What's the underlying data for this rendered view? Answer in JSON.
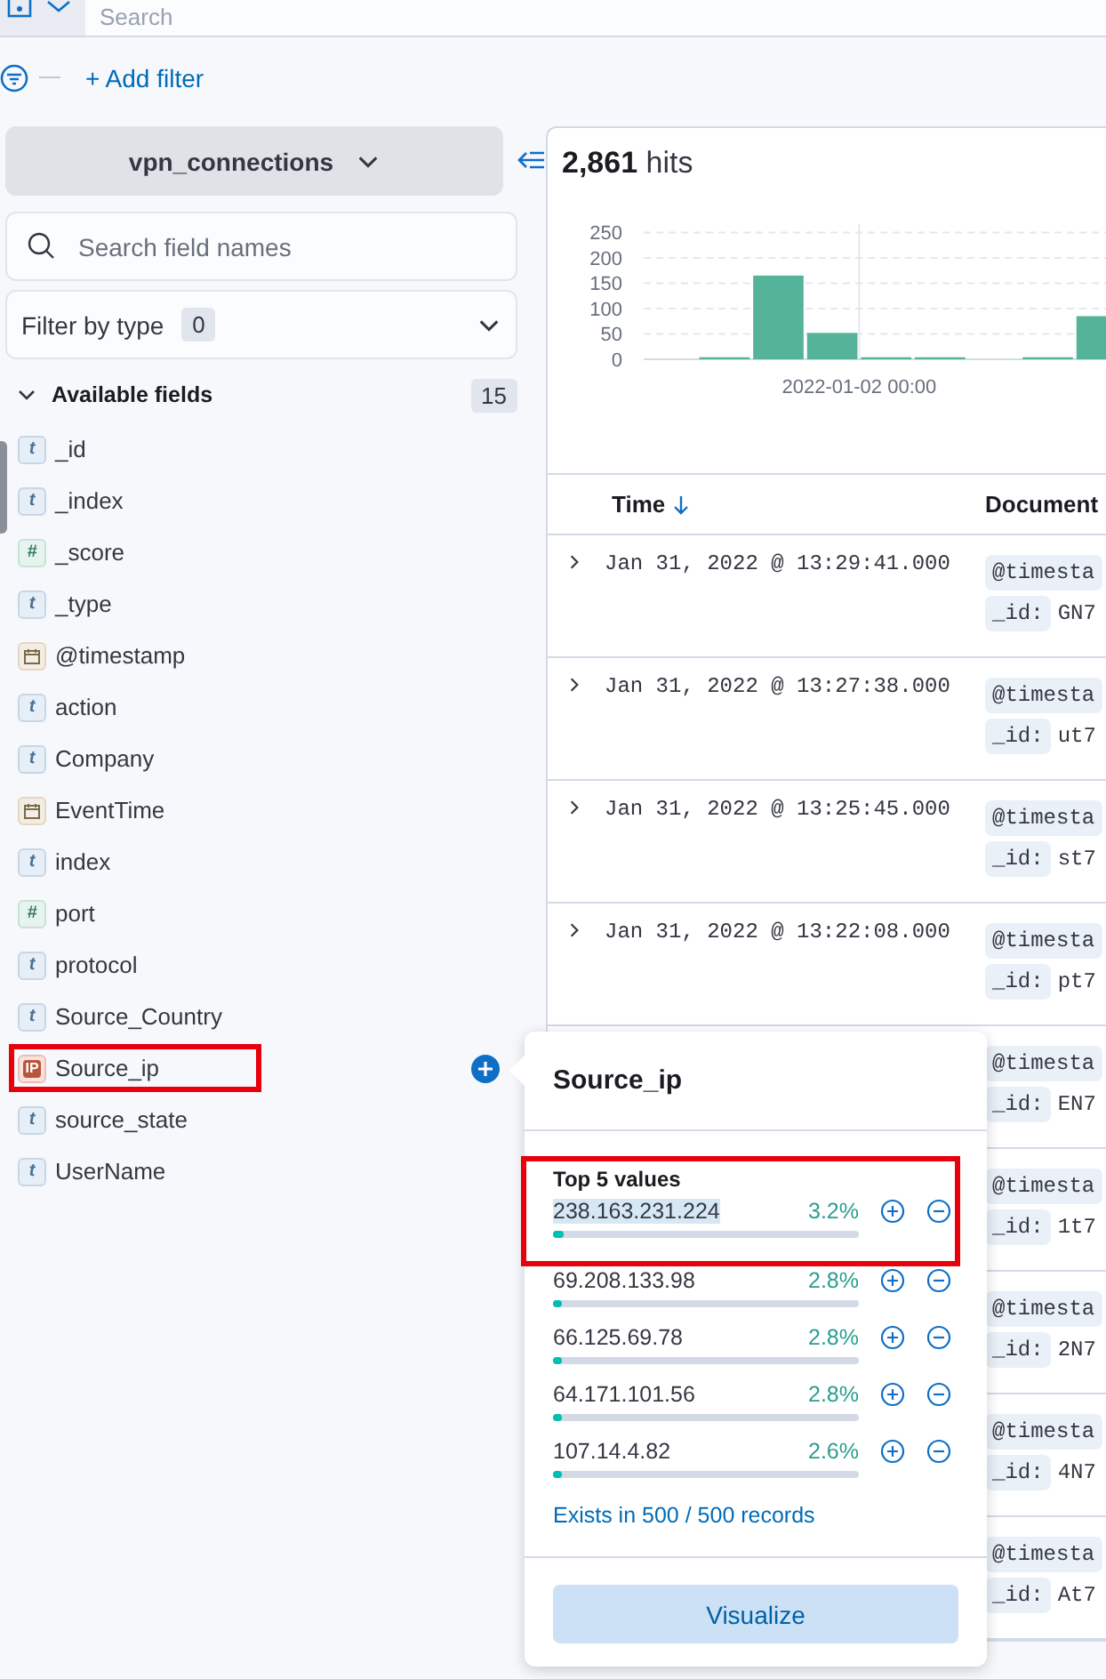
{
  "top_bar": {
    "search_placeholder": "Search"
  },
  "filter_bar": {
    "add_filter": "+ Add filter"
  },
  "sidebar": {
    "index_pattern": "vpn_connections",
    "search_placeholder": "Search field names",
    "filter_by_type": {
      "label": "Filter by type",
      "count": "0"
    },
    "available_fields": {
      "label": "Available fields",
      "count": "15",
      "expanded": true,
      "fields": [
        {
          "kind": "string",
          "token": "t",
          "name": "_id",
          "selected": false,
          "highlighted": false
        },
        {
          "kind": "string",
          "token": "t",
          "name": "_index",
          "selected": false,
          "highlighted": false
        },
        {
          "kind": "number",
          "token": "#",
          "name": "_score",
          "selected": false,
          "highlighted": false
        },
        {
          "kind": "string",
          "token": "t",
          "name": "_type",
          "selected": false,
          "highlighted": false
        },
        {
          "kind": "date",
          "name": "@timestamp",
          "selected": false,
          "highlighted": false
        },
        {
          "kind": "string",
          "token": "t",
          "name": "action",
          "selected": false,
          "highlighted": false
        },
        {
          "kind": "string",
          "token": "t",
          "name": "Company",
          "selected": false,
          "highlighted": false
        },
        {
          "kind": "date",
          "name": "EventTime",
          "selected": false,
          "highlighted": false
        },
        {
          "kind": "string",
          "token": "t",
          "name": "index",
          "selected": false,
          "highlighted": false
        },
        {
          "kind": "number",
          "token": "#",
          "name": "port",
          "selected": false,
          "highlighted": false
        },
        {
          "kind": "string",
          "token": "t",
          "name": "protocol",
          "selected": false,
          "highlighted": false
        },
        {
          "kind": "string",
          "token": "t",
          "name": "Source_Country",
          "selected": false,
          "highlighted": false
        },
        {
          "kind": "ip",
          "token": "IP",
          "name": "Source_ip",
          "selected": true,
          "highlighted": true
        },
        {
          "kind": "string",
          "token": "t",
          "name": "source_state",
          "selected": false,
          "highlighted": false
        },
        {
          "kind": "string",
          "token": "t",
          "name": "UserName",
          "selected": false,
          "highlighted": false
        }
      ]
    }
  },
  "results": {
    "hits_count": "2,861",
    "hits_label": "hits",
    "chart_data": {
      "type": "bar",
      "categories": [
        null,
        null,
        null,
        null,
        null,
        null,
        null,
        null,
        null
      ],
      "grid": true,
      "values": [
        0,
        4,
        165,
        52,
        4,
        4,
        0,
        4,
        85
      ],
      "ylim": [
        0,
        270
      ],
      "yticks": [
        {
          "value": 0,
          "label": "0"
        },
        {
          "value": 50,
          "label": "50"
        },
        {
          "value": 100,
          "label": "100"
        },
        {
          "value": 150,
          "label": "150"
        },
        {
          "value": 200,
          "label": "200"
        },
        {
          "value": 250,
          "label": "250"
        }
      ],
      "annotations": [
        "2022-01-02 00:00"
      ]
    },
    "table": {
      "columns": [
        {
          "label": "Time",
          "sorted": true
        },
        {
          "label": "Document"
        }
      ],
      "rows": [
        {
          "time": "Jan 31, 2022 @ 13:29:41.000",
          "chips": [
            {
              "key": "@timesta"
            },
            {
              "key": "_id:",
              "value": "GN7"
            }
          ]
        },
        {
          "time": "Jan 31, 2022 @ 13:27:38.000",
          "chips": [
            {
              "key": "@timesta"
            },
            {
              "key": "_id:",
              "value": "ut7"
            }
          ]
        },
        {
          "time": "Jan 31, 2022 @ 13:25:45.000",
          "chips": [
            {
              "key": "@timesta"
            },
            {
              "key": "_id:",
              "value": "st7"
            }
          ]
        },
        {
          "time": "Jan 31, 2022 @ 13:22:08.000",
          "chips": [
            {
              "key": "@timesta"
            },
            {
              "key": "_id:",
              "value": "pt7"
            }
          ]
        },
        {
          "chips": [
            {
              "key": "@timesta"
            },
            {
              "key": "_id:",
              "value": "EN7"
            }
          ]
        },
        {
          "chips": [
            {
              "key": "@timesta"
            },
            {
              "key": "_id:",
              "value": "1t7"
            }
          ]
        },
        {
          "chips": [
            {
              "key": "@timesta"
            },
            {
              "key": "_id:",
              "value": "2N7"
            }
          ]
        },
        {
          "chips": [
            {
              "key": "@timesta"
            },
            {
              "key": "_id:",
              "value": "4N7"
            }
          ]
        },
        {
          "chips": [
            {
              "key": "@timesta"
            },
            {
              "key": "_id:",
              "value": "At7"
            }
          ]
        }
      ]
    }
  },
  "popover": {
    "title": "Source_ip",
    "top_values_label": "Top 5 values",
    "first_value_highlighted": true,
    "values": [
      {
        "value": "238.163.231.224",
        "percent": "3.2%",
        "level": 0.032,
        "text_selected": true
      },
      {
        "value": "69.208.133.98",
        "percent": "2.8%",
        "level": 0.028,
        "text_selected": false
      },
      {
        "value": "66.125.69.78",
        "percent": "2.8%",
        "level": 0.028,
        "text_selected": false
      },
      {
        "value": "64.171.101.56",
        "percent": "2.8%",
        "level": 0.028,
        "text_selected": false
      },
      {
        "value": "107.14.4.82",
        "percent": "2.6%",
        "level": 0.026,
        "text_selected": false
      }
    ],
    "exists_link": "Exists in 500 / 500 records",
    "visualize_button": "Visualize"
  }
}
